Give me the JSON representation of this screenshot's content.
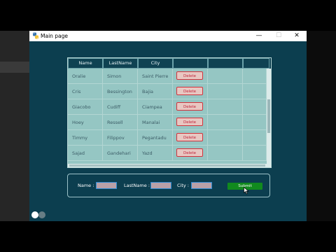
{
  "window": {
    "title": "Main page",
    "minimize": "—",
    "maximize": "☐",
    "close": "✕"
  },
  "table": {
    "headers": [
      "Name",
      "LastName",
      "City",
      "",
      "",
      ""
    ],
    "delete_label": "Delete",
    "rows": [
      {
        "name": "Oralie",
        "lastname": "Simon",
        "city": "Saint Pierre"
      },
      {
        "name": "Cris",
        "lastname": "Bessington",
        "city": "Bajia"
      },
      {
        "name": "Giacobo",
        "lastname": "Cudiff",
        "city": "Ciampea"
      },
      {
        "name": "Hoey",
        "lastname": "Ressell",
        "city": "Manalai"
      },
      {
        "name": "Timmy",
        "lastname": "Filippov",
        "city": "Pegantadu"
      },
      {
        "name": "Sajad",
        "lastname": "Gandehari",
        "city": "Yazd"
      }
    ]
  },
  "form": {
    "name_label": "Name :",
    "name_value": "",
    "lastname_label": "LastName :",
    "lastname_value": "",
    "city_label": "City :",
    "city_value": "",
    "submit_label": "Submit"
  },
  "colors": {
    "window_bg": "#0c3e4f",
    "table_bg": "#95c6c3",
    "delete_border": "#d2333c",
    "submit_bg": "#118a1e",
    "input_bg": "#b9a0a8"
  }
}
